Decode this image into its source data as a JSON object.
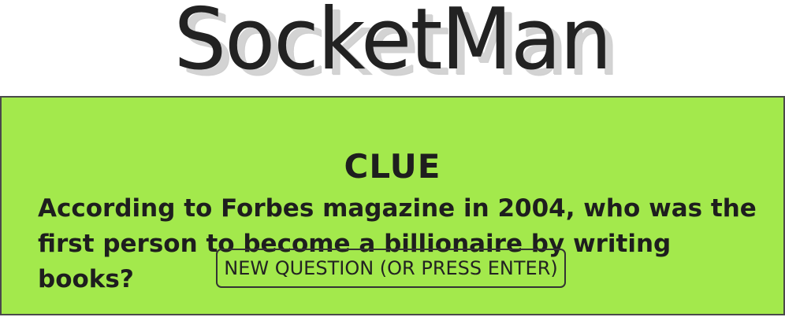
{
  "header": {
    "logo_text": "SocketMan"
  },
  "clue_panel": {
    "heading": "CLUE",
    "question": "According to Forbes magazine in 2004, who was the first person to become a billionaire by writing books?",
    "new_question_label": "NEW QUESTION (OR PRESS ENTER)"
  },
  "colors": {
    "panel_background": "#a3e94c",
    "text": "#1e1e1e",
    "logo_shadow": "#d3d3d3"
  }
}
